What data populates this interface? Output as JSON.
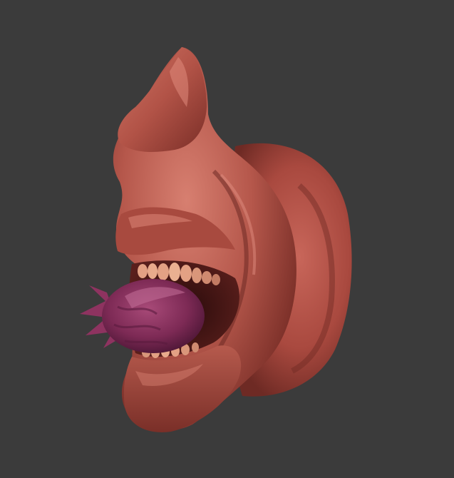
{
  "scene": {
    "subject": "sculpted-head-render",
    "background_color": "#3b3b3b",
    "colors": {
      "skin_base": "#b8574a",
      "skin_highlight": "#e58c7c",
      "skin_shadow": "#6e2a24",
      "skin_deep_shadow": "#4d1a16",
      "fruit_base": "#7d2a55",
      "fruit_highlight": "#b85a86",
      "fruit_shadow": "#4a1534",
      "teeth": "#e3a184",
      "teeth_shadow": "#a8584a",
      "mouth_interior": "#3a1212"
    }
  }
}
